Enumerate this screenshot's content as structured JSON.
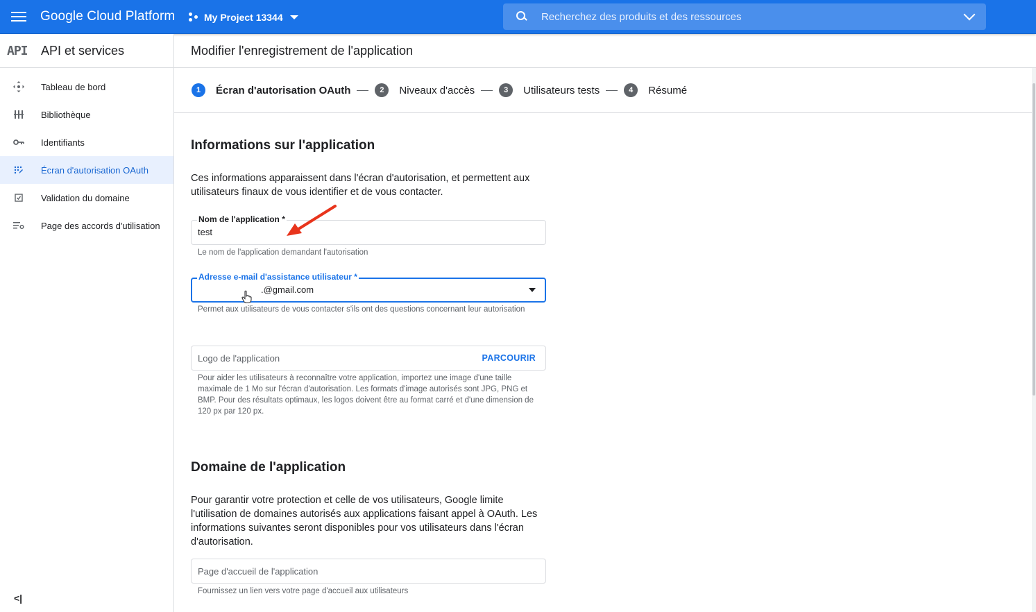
{
  "topbar": {
    "brand": "Google Cloud Platform",
    "project": "My Project 13344",
    "search_placeholder": "Recherchez des produits et des ressources"
  },
  "sidebar": {
    "logo": "API",
    "title": "API et services",
    "items": [
      {
        "label": "Tableau de bord",
        "icon": "dashboard-icon",
        "active": false
      },
      {
        "label": "Bibliothèque",
        "icon": "library-icon",
        "active": false
      },
      {
        "label": "Identifiants",
        "icon": "key-icon",
        "active": false
      },
      {
        "label": "Écran d'autorisation OAuth",
        "icon": "oauth-consent-icon",
        "active": true
      },
      {
        "label": "Validation du domaine",
        "icon": "checkbox-icon",
        "active": false
      },
      {
        "label": "Page des accords d'utilisation",
        "icon": "settings-list-icon",
        "active": false
      }
    ],
    "collapse_glyph": "<|"
  },
  "page": {
    "title": "Modifier l'enregistrement de l'application"
  },
  "stepper": [
    {
      "num": "1",
      "label": "Écran d'autorisation OAuth",
      "active": true
    },
    {
      "num": "2",
      "label": "Niveaux d'accès",
      "active": false
    },
    {
      "num": "3",
      "label": "Utilisateurs tests",
      "active": false
    },
    {
      "num": "4",
      "label": "Résumé",
      "active": false
    }
  ],
  "app_info": {
    "heading": "Informations sur l'application",
    "description": "Ces informations apparaissent dans l'écran d'autorisation, et permettent aux utilisateurs finaux de vous identifier et de vous contacter.",
    "app_name": {
      "label": "Nom de l'application *",
      "value": "test",
      "hint": "Le nom de l'application demandant l'autorisation"
    },
    "support_email": {
      "label": "Adresse e-mail d'assistance utilisateur *",
      "value": ".@gmail.com",
      "hint": "Permet aux utilisateurs de vous contacter s'ils ont des questions concernant leur autorisation"
    },
    "logo": {
      "placeholder": "Logo de l'application",
      "browse": "PARCOURIR",
      "hint": "Pour aider les utilisateurs à reconnaître votre application, importez une image d'une taille maximale de 1 Mo sur l'écran d'autorisation. Les formats d'image autorisés sont JPG, PNG et BMP. Pour des résultats optimaux, les logos doivent être au format carré et d'une dimension de 120 px par 120 px."
    }
  },
  "app_domain": {
    "heading": "Domaine de l'application",
    "description": "Pour garantir votre protection et celle de vos utilisateurs, Google limite l'utilisation de domaines autorisés aux applications faisant appel à OAuth. Les informations suivantes seront disponibles pour vos utilisateurs dans l'écran d'autorisation.",
    "homepage": {
      "placeholder": "Page d'accueil de l'application",
      "hint": "Fournissez un lien vers votre page d'accueil aux utilisateurs"
    }
  },
  "colors": {
    "topbar": "#1a73e8",
    "accent": "#1a73e8",
    "annotation_arrow": "#e8341c"
  }
}
